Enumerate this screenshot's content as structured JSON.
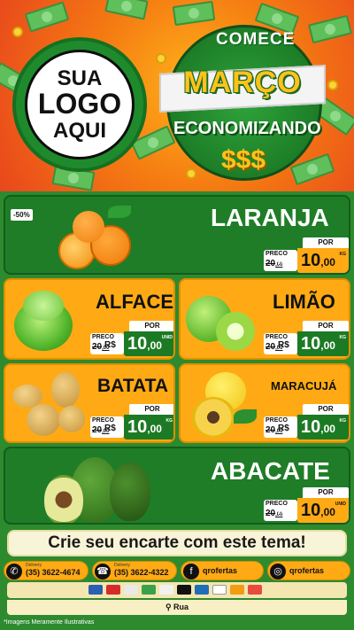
{
  "header": {
    "logo_lines": [
      "SUA",
      "LOGO",
      "AQUI"
    ],
    "line1": "COMECE",
    "line2": "MARÇO",
    "line3": "ECONOMIZANDO",
    "line4": "$$$"
  },
  "products": [
    {
      "name": "LARANJA",
      "badge": "-50%",
      "preco_label": "PRECO",
      "old_int": "20",
      "old_cents": ",00",
      "por_label": "POR",
      "currency": "R$",
      "int": "10",
      "cents": ",00",
      "unit": "KG"
    },
    {
      "name": "ALFACE",
      "preco_label": "PRECO",
      "old_int": "20",
      "old_cents": ",00",
      "por_label": "POR",
      "currency": "R$",
      "int": "10",
      "cents": ",00",
      "unit": "UNID"
    },
    {
      "name": "LIMÃO",
      "preco_label": "PRECO",
      "old_int": "20",
      "old_cents": ",00",
      "por_label": "POR",
      "currency": "R$",
      "int": "10",
      "cents": ",00",
      "unit": "KG"
    },
    {
      "name": "BATATA",
      "preco_label": "PRECO",
      "old_int": "20",
      "old_cents": ",00",
      "por_label": "POR",
      "currency": "R$",
      "int": "10",
      "cents": ",00",
      "unit": "KG"
    },
    {
      "name": "MARACUJÁ",
      "preco_label": "PRECO",
      "old_int": "20",
      "old_cents": ",00",
      "por_label": "POR",
      "currency": "R$",
      "int": "10",
      "cents": ",00",
      "unit": "KG"
    },
    {
      "name": "ABACATE",
      "preco_label": "PRECO",
      "old_int": "20",
      "old_cents": ",00",
      "por_label": "POR",
      "currency": "R$",
      "int": "10",
      "cents": ",00",
      "unit": "UNID"
    }
  ],
  "footer": {
    "cta": "Crie seu encarte com este tema!",
    "whatsapp": {
      "small": "Delivery",
      "number": "(35) 3622-4674"
    },
    "phone": {
      "small": "Delivery",
      "number": "(35) 3622-4322"
    },
    "facebook": "qrofertas",
    "instagram": "qrofertas",
    "address": "Rua",
    "note": "*Imagens Meramente Ilustrativas"
  },
  "icons": {
    "whatsapp": "whatsapp-icon",
    "phone": "phone-icon",
    "facebook": "facebook-icon",
    "instagram": "instagram-icon",
    "location": "map-pin-icon"
  },
  "colors": {
    "orange": "#ffaa14",
    "green": "#1f7d27",
    "background": "#2d8a2f"
  }
}
